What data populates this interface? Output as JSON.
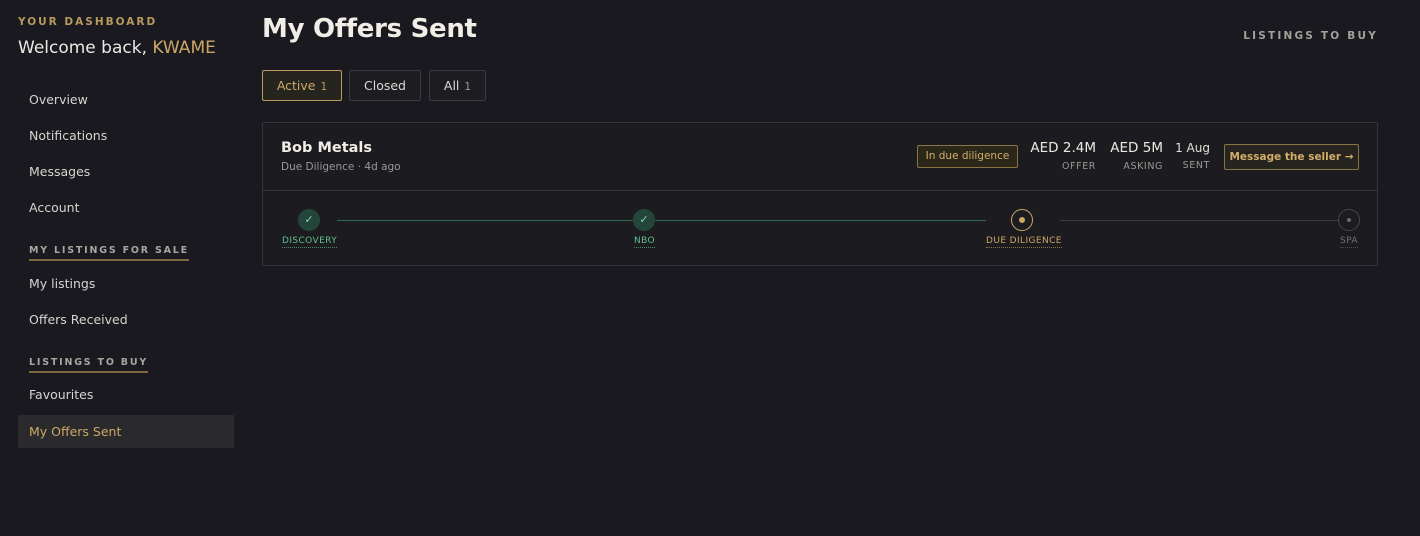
{
  "sidebar": {
    "dashboard_label": "YOUR DASHBOARD",
    "welcome_prefix": "Welcome back,",
    "user_name": "KWAME",
    "nav_main": [
      "Overview",
      "Notifications",
      "Messages",
      "Account"
    ],
    "section_sale": "MY LISTINGS FOR SALE",
    "nav_sale": [
      "My listings",
      "Offers Received"
    ],
    "section_buy": "LISTINGS TO BUY",
    "nav_buy": [
      "Favourites",
      "My Offers Sent"
    ]
  },
  "header": {
    "title": "My Offers Sent",
    "top_link": "LISTINGS TO BUY"
  },
  "tabs": [
    {
      "label": "Active",
      "count": "1"
    },
    {
      "label": "Closed",
      "count": ""
    },
    {
      "label": "All",
      "count": "1"
    }
  ],
  "offer": {
    "company": "Bob Metals",
    "subtitle": "Due Diligence · 4d ago",
    "status_badge": "In due diligence",
    "offer_value": "AED 2.4M",
    "offer_label": "OFFER",
    "asking_value": "AED 5M",
    "asking_label": "ASKING",
    "sent_value": "1 Aug",
    "sent_label": "SENT",
    "message_button": "Message the seller →",
    "steps": [
      {
        "label": "DISCOVERY",
        "state": "done"
      },
      {
        "label": "NBO",
        "state": "done"
      },
      {
        "label": "DUE DILIGENCE",
        "state": "current"
      },
      {
        "label": "SPA",
        "state": "future"
      }
    ]
  },
  "icons": {
    "check": "check-icon",
    "current": "current-step-icon",
    "pending": "pending-step-icon"
  },
  "colors": {
    "accent": "#cda865",
    "background": "#19191f",
    "success": "#5fbf8c"
  }
}
